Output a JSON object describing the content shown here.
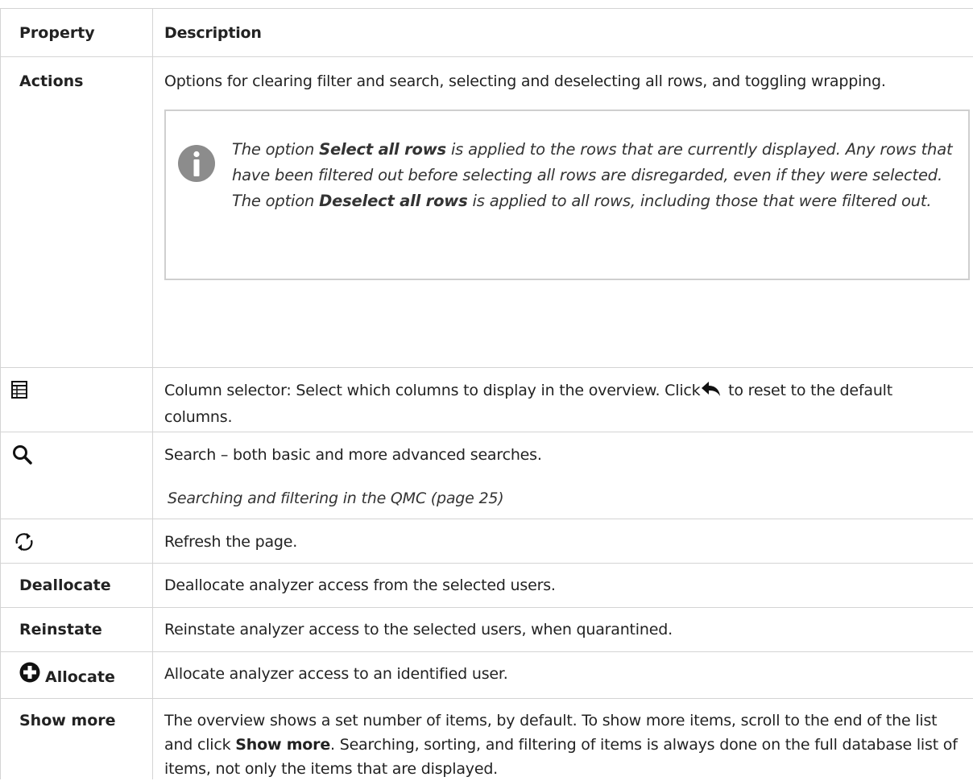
{
  "header": {
    "property": "Property",
    "description": "Description"
  },
  "actions": {
    "label": "Actions",
    "description": "Options for clearing filter and search, selecting and deselecting all rows, and toggling wrapping.",
    "note": {
      "part1": "The option ",
      "bold1": "Select all rows",
      "part2": " is applied to the rows that are currently displayed. Any rows that have been filtered out before selecting all rows are disregarded, even if they were selected. The option ",
      "bold2": "Deselect all rows",
      "part3": " is applied to all rows, including those that were filtered out."
    }
  },
  "column_selector": {
    "icon": "table-icon",
    "text_before": "Column selector: Select which columns to display in the overview. Click ",
    "reset_icon": "undo-arrow-icon",
    "text_after": " to reset to the default columns."
  },
  "search": {
    "icon": "search-icon",
    "description": "Search – both basic and more advanced searches.",
    "link": "Searching and filtering in the QMC (page 25)"
  },
  "refresh": {
    "icon": "refresh-icon",
    "description": "Refresh the page."
  },
  "deallocate": {
    "label": "Deallocate",
    "description": "Deallocate analyzer access from the selected users."
  },
  "reinstate": {
    "label": "Reinstate",
    "description": "Reinstate analyzer access to the selected users, when quarantined."
  },
  "allocate": {
    "icon": "plus-circle-icon",
    "label": "Allocate",
    "description": "Allocate analyzer access to an identified user."
  },
  "show_more": {
    "label": "Show more",
    "text_before": "The overview shows a set number of items, by default. To show more items, scroll to the end of the list and click ",
    "bold": "Show more",
    "text_after": ". Searching, sorting, and filtering of items is always done on the full database list of items, not only the items that are displayed."
  },
  "colors": {
    "border": "#d4d4d4",
    "note_border": "#cfcfcf",
    "info_icon": "#8c8c8c",
    "text": "#222222"
  }
}
